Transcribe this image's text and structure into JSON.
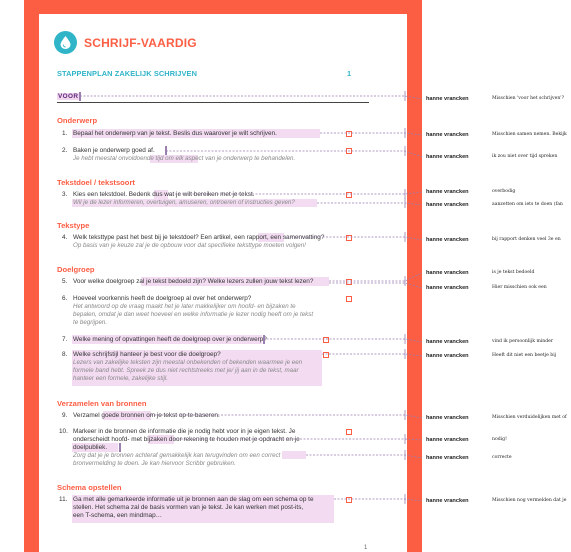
{
  "doc": {
    "title": "SCHRIJF-VAARDIG",
    "subtitle": "STAPPENPLAN ZAKELIJK SCHRIJVEN",
    "page_number": "1",
    "footer_page": "1",
    "voor_label": "VOOR",
    "sections": {
      "onderwerp": "Onderwerp",
      "tekstdoel": "Tekstdoel / tekstsoort",
      "tekstype": "Tekstype",
      "doelgroep": "Doelgroep",
      "bronnen": "Verzamelen van bronnen",
      "schema": "Schema opstellen"
    },
    "steps": {
      "s1_num": "1.",
      "s1": "Bepaal het onderwerp van je tekst. Beslis dus waarover je wilt schrijven.",
      "s2_num": "2.",
      "s2": "Baken je onderwerp goed af.",
      "s2_hint": "Je hebt meestal onvoldoende tijd om elk aspect van je onderwerp te behandelen.",
      "s3_num": "3.",
      "s3": "Kies een tekstdoel. Bedenk dus wat je wilt bereiken met je tekst.",
      "s3_hint": "Wil je de lezer informeren, overtuigen, amuseren, ontroeren of instructies geven?",
      "s4_num": "4.",
      "s4": "Welk teksttype past het best bij je tekstdoel? Een artikel, een rapport, een samenvatting?",
      "s4_hint": "Op basis van je keuze zal je de opbouw voor dat specifieke teksttype moeten volgen!",
      "s5_num": "5.",
      "s5": "Voor welke doelgroep zal je tekst bedoeld zijn? Welke lezers zullen jouw tekst lezen?",
      "s6_num": "6.",
      "s6": "Hoeveel voorkennis heeft de doelgroep al over het onderwerp?",
      "s6_hint1": "Het antwoord op de vraag maakt het je later makkelijker om hoofd- en bijzaken te",
      "s6_hint2": "bepalen, omdat je dan weet hoeveel en welke informatie je lezer nodig heeft om je tekst",
      "s6_hint3": "te begrijpen.",
      "s7_num": "7.",
      "s7": "Welke mening of opvattingen heeft de doelgroep over je onderwerp?",
      "s8_num": "8.",
      "s8": "Welke schrijfstijl hanteer je best voor die doelgroep?",
      "s8_hint1": "Lezers van zakelijke teksten zijn meestal onbekenden of bekenden waarmee je een",
      "s8_hint2": "formele band hebt. Spreek ze dus niet rechtstreeks met je/ jij aan in de tekst, maar",
      "s8_hint3": "hanteer een formele, zakelijke stijl.",
      "s9_num": "9.",
      "s9": "Verzamel goede bronnen om je tekst op te baseren.",
      "s10_num": "10.",
      "s10_1": "Markeer in de bronnen de informatie die je nodig hebt voor in je eigen tekst. Je",
      "s10_2": "onderscheidt hoofd- met bijzaken door rekening te houden met je opdracht en je",
      "s10_3": "doelpubliek.",
      "s10_hint1": "Zorg dat je je bronnen achteraf gemakkelijk kan terugvinden om een correct",
      "s10_hint2": "bronvermelding te doen. Je kan hiervoor Scribbr gebruiken.",
      "s11_num": "11.",
      "s11_1": "Ga met alle gemarkeerde informatie uit je bronnen aan de slag om een schema op te",
      "s11_2": "stellen. Het schema zal de basis vormen van je tekst. Je kan werken met post-its,",
      "s11_3": "een T-schema, een mindmap…"
    }
  },
  "comments": [
    {
      "author": "hanne vrancken",
      "text": "Misschien 'voor het schrijven'?"
    },
    {
      "author": "hanne vrancken",
      "text": "Misschien samen nemen. Bekijk"
    },
    {
      "author": "hanne vrancken",
      "text": "ik zou niet over tijd spreken"
    },
    {
      "author": "hanne vrancken",
      "text": "overbodig"
    },
    {
      "author": "hanne vrancken",
      "text": "aanzetten om iets te doen (fan"
    },
    {
      "author": "hanne vrancken",
      "text": "bij rapport denken veel 3e en"
    },
    {
      "author": "hanne vrancken",
      "text": "is je tekst bedoeld"
    },
    {
      "author": "hanne vrancken",
      "text": "Hier misschien ook een"
    },
    {
      "author": "hanne vrancken",
      "text": "vind ik persoonlijk minder"
    },
    {
      "author": "hanne vrancken",
      "text": "Heeft dit niet een beetje bij"
    },
    {
      "author": "hanne vrancken",
      "text": "Misschien verduidelijken met of"
    },
    {
      "author": "hanne vrancken",
      "text": "nodig!"
    },
    {
      "author": "hanne vrancken",
      "text": "correcte"
    },
    {
      "author": "hanne vrancken",
      "text": "Misschien nog vermelden dat je"
    }
  ],
  "colors": {
    "accent": "#fc5e44",
    "heading": "#2fb4c8",
    "highlight": "#f3dcf2",
    "comment_line": "#9a7fb0"
  }
}
